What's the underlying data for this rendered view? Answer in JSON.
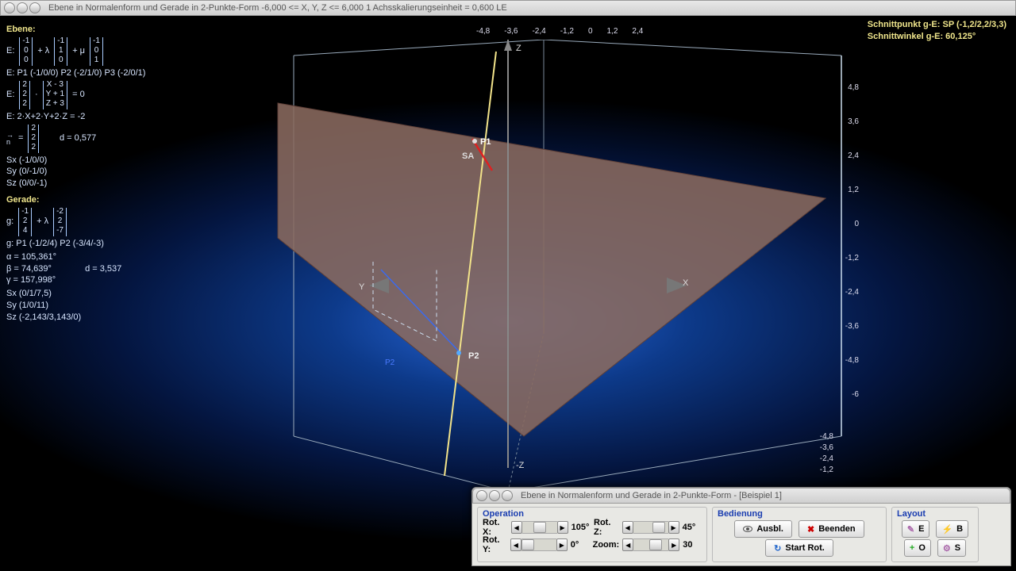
{
  "main_window": {
    "title": "Ebene in Normalenform und Gerade in 2-Punkte-Form    -6,000 <= X, Y, Z <= 6,000    1 Achsskalierungseinheit = 0,600 LE"
  },
  "results": {
    "line1": "Schnittpunkt g-E: SP (-1,2/2,2/3,3)",
    "line2": "Schnittwinkel g-E: 60,125°"
  },
  "math": {
    "ebene_hdr": "Ebene:",
    "e_prefix": "E:",
    "e_v1": [
      "-1",
      "0",
      "0"
    ],
    "e_lam": "+ λ",
    "e_v2": [
      "-1",
      "1",
      "0"
    ],
    "e_mu": "+ μ",
    "e_v3": [
      "-1",
      "0",
      "1"
    ],
    "e_pts": "E: P1 (-1/0/0)    P2 (-2/1/0)    P3 (-2/0/1)",
    "e_n1": [
      "2",
      "2",
      "2"
    ],
    "e_dot": "·",
    "e_n2": [
      "X - 3",
      "Y + 1",
      "Z + 3"
    ],
    "e_eq0": "= 0",
    "e_cart": "E: 2·X+2·Y+2·Z = -2",
    "n_arrow": "→\nn",
    "n_eq": "=",
    "n_vec": [
      "2",
      "2",
      "2"
    ],
    "d_lbl": "d = 0,577",
    "sx": "Sx (-1/0/0)",
    "sy": "Sy (0/-1/0)",
    "sz": "Sz (0/0/-1)",
    "gerade_hdr": "Gerade:",
    "g_prefix": "g:",
    "g_v1": [
      "-1",
      "2",
      "4"
    ],
    "g_lam": "+ λ",
    "g_v2": [
      "-2",
      "2",
      "-7"
    ],
    "g_pts": "g: P1 (-1/2/4)    P2 (-3/4/-3)",
    "alpha": "α = 105,361°",
    "beta": "β = 74,639°",
    "gamma": "γ = 157,998°",
    "d2": "d = 3,537",
    "gsx": "Sx (0/1/7,5)",
    "gsy": "Sy (1/0/11)",
    "gsz": "Sz (-2,143/3,143/0)"
  },
  "axes": {
    "top": [
      "-4,8",
      "-3,6",
      "-2,4",
      "-1,2",
      "0",
      "1,2",
      "2,4"
    ],
    "right": [
      "4,8",
      "3,6",
      "2,4",
      "1,2",
      "0",
      "-1,2",
      "-2,4",
      "-3,6",
      "-4,8",
      "-6"
    ],
    "z_label": "Z",
    "mz_label": "-Z",
    "x_label": "X",
    "y_label": "Y",
    "br": [
      "-4,8",
      "-3,6",
      "-2,4",
      "-1,2"
    ]
  },
  "scene": {
    "p1": "P1",
    "p2": "P2",
    "p2b": "P2",
    "sa": "SA"
  },
  "control_window": {
    "title": "Ebene in Normalenform und Gerade in 2-Punkte-Form - [Beispiel 1]",
    "operation_label": "Operation",
    "rotx_label": "Rot. X:",
    "rotx_val": "105°",
    "roty_label": "Rot. Y:",
    "roty_val": "0°",
    "rotz_label": "Rot. Z:",
    "rotz_val": "45°",
    "zoom_label": "Zoom:",
    "zoom_val": "30",
    "bedienung_label": "Bedienung",
    "ausbl": "Ausbl.",
    "beenden": "Beenden",
    "startrot": "Start Rot.",
    "layout_label": "Layout",
    "btn_e": "E",
    "btn_b": "B",
    "btn_o": "O",
    "btn_s": "S"
  }
}
